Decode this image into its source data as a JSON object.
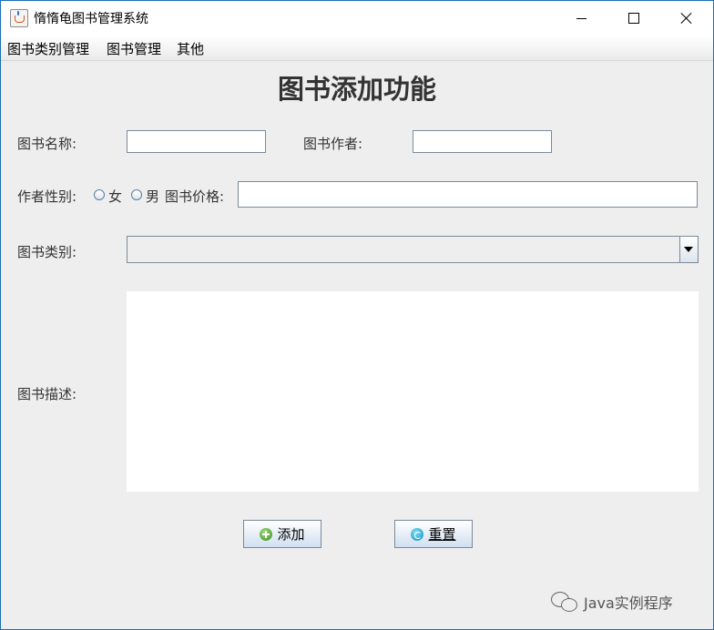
{
  "window": {
    "title": "惰惰龟图书管理系统",
    "app_icon": "java-cup-icon"
  },
  "menubar": {
    "items": [
      {
        "label": "图书类别管理"
      },
      {
        "label": "图书管理"
      },
      {
        "label": "其他"
      }
    ]
  },
  "form": {
    "heading": "图书添加功能",
    "book_name_label": "图书名称:",
    "book_name_value": "",
    "author_label": "图书作者:",
    "author_value": "",
    "author_gender_label": "作者性别:",
    "gender_options": [
      {
        "label": "女",
        "selected": false
      },
      {
        "label": "男",
        "selected": false
      }
    ],
    "price_label": "图书价格:",
    "price_value": "",
    "category_label": "图书类别:",
    "category_selected": "",
    "description_label": "图书描述:",
    "description_value": ""
  },
  "buttons": {
    "add_label": "添加",
    "reset_label": "重置"
  },
  "watermark": {
    "text": "Java实例程序"
  },
  "colors": {
    "window_border": "#1b6fb8",
    "background": "#eeeeee",
    "heading": "#333333"
  }
}
